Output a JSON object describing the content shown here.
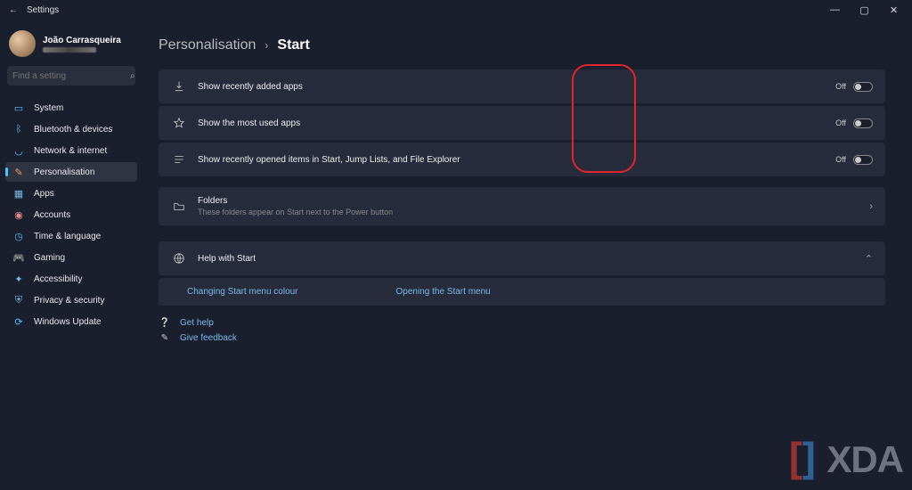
{
  "titlebar": {
    "title": "Settings"
  },
  "user": {
    "name": "João Carrasqueira"
  },
  "search": {
    "placeholder": "Find a setting"
  },
  "nav": [
    {
      "label": "System",
      "icon": "system"
    },
    {
      "label": "Bluetooth & devices",
      "icon": "bluetooth"
    },
    {
      "label": "Network & internet",
      "icon": "wifi"
    },
    {
      "label": "Personalisation",
      "icon": "brush",
      "active": true
    },
    {
      "label": "Apps",
      "icon": "apps"
    },
    {
      "label": "Accounts",
      "icon": "person"
    },
    {
      "label": "Time & language",
      "icon": "clock"
    },
    {
      "label": "Gaming",
      "icon": "game"
    },
    {
      "label": "Accessibility",
      "icon": "access"
    },
    {
      "label": "Privacy & security",
      "icon": "shield"
    },
    {
      "label": "Windows Update",
      "icon": "update"
    }
  ],
  "breadcrumb": {
    "parent": "Personalisation",
    "current": "Start"
  },
  "rows": {
    "recentlyAdded": {
      "label": "Show recently added apps",
      "state": "Off"
    },
    "mostUsed": {
      "label": "Show the most used apps",
      "state": "Off"
    },
    "recentItems": {
      "label": "Show recently opened items in Start, Jump Lists, and File Explorer",
      "state": "Off"
    },
    "folders": {
      "label": "Folders",
      "sub": "These folders appear on Start next to the Power button"
    }
  },
  "help": {
    "title": "Help with Start",
    "links": [
      "Changing Start menu colour",
      "Opening the Start menu"
    ]
  },
  "footer": {
    "getHelp": "Get help",
    "feedback": "Give feedback"
  },
  "watermark": "XDA"
}
